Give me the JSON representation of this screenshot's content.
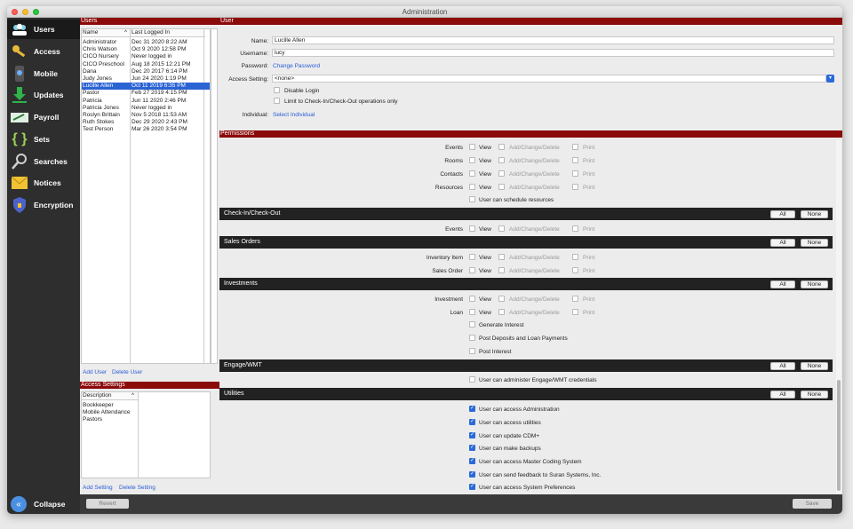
{
  "window": {
    "title": "Administration"
  },
  "nav": {
    "items": [
      {
        "label": "Users",
        "icon": "users-icon",
        "active": true
      },
      {
        "label": "Access",
        "icon": "key-icon"
      },
      {
        "label": "Mobile",
        "icon": "mobile-icon"
      },
      {
        "label": "Updates",
        "icon": "download-icon"
      },
      {
        "label": "Payroll",
        "icon": "payroll-icon"
      },
      {
        "label": "Sets",
        "icon": "braces-icon"
      },
      {
        "label": "Searches",
        "icon": "magnifier-icon"
      },
      {
        "label": "Notices",
        "icon": "envelope-icon"
      },
      {
        "label": "Encryption",
        "icon": "shield-icon"
      }
    ],
    "collapse_label": "Collapse"
  },
  "users_panel": {
    "header": "Users",
    "col_name": "Name",
    "col_last": "Last Logged In",
    "rows": [
      {
        "name": "Administrator",
        "last": "Dec 31 2020 8:22 AM"
      },
      {
        "name": "Chris Watson",
        "last": "Oct 9 2020 12:58 PM"
      },
      {
        "name": "CICO Nursery",
        "last": "Never logged in"
      },
      {
        "name": "CICO Preschool",
        "last": "Aug 18 2015 12:21 PM"
      },
      {
        "name": "Dana",
        "last": "Dec 20 2017 6:14 PM"
      },
      {
        "name": "Judy Jones",
        "last": "Jun 24 2020 1:19 PM"
      },
      {
        "name": "Lucille Allen",
        "last": "Oct 11 2019 6:35 PM",
        "selected": true
      },
      {
        "name": "Pastor",
        "last": "Feb 27 2019 4:15 PM"
      },
      {
        "name": "Patricia",
        "last": "Jun 11 2020 2:46 PM"
      },
      {
        "name": "Patricia Jones",
        "last": "Never logged in"
      },
      {
        "name": "Roslyn Brittain",
        "last": "Nov 5 2018 11:53 AM"
      },
      {
        "name": "Ruth Stokes",
        "last": "Dec 29 2020 2:43 PM"
      },
      {
        "name": "Test Person",
        "last": "Mar 26 2020 3:54 PM"
      }
    ],
    "add_user": "Add User",
    "delete_user": "Delete User"
  },
  "access_panel": {
    "header": "Access Settings",
    "col_desc": "Description",
    "rows": [
      "Bookkeeper",
      "Mobile Attendance",
      "Pastors"
    ],
    "add_setting": "Add Setting",
    "delete_setting": "Delete Setting"
  },
  "user_form": {
    "header": "User",
    "name_label": "Name:",
    "name_value": "Lucille Allen",
    "username_label": "Username:",
    "username_value": "lucy",
    "password_label": "Password:",
    "change_password": "Change Password",
    "access_label": "Access Setting:",
    "access_value": "<none>",
    "disable_login": "Disable Login",
    "limit_checkin": "Limit to Check-In/Check-Out operations only",
    "individual_label": "Individual:",
    "select_individual": "Select Individual"
  },
  "permissions": {
    "header": "Permissions",
    "view": "View",
    "add_change_delete": "Add/Change/Delete",
    "print": "Print",
    "all": "All",
    "none": "None",
    "top_rows": [
      "Events",
      "Rooms",
      "Contacts",
      "Resources"
    ],
    "schedule_resources": "User can schedule resources",
    "sections": [
      {
        "title": "Check-In/Check-Out",
        "rows": [
          "Events"
        ]
      },
      {
        "title": "Sales Orders",
        "rows": [
          "Inventory Item",
          "Sales Order"
        ]
      },
      {
        "title": "Investments",
        "rows": [
          "Investment",
          "Loan"
        ],
        "extras": [
          "Generate Interest",
          "Post Deposits and Loan Payments",
          "Post Interest"
        ]
      },
      {
        "title": "Engage/WMT",
        "extras": [
          "User can administer Engage/WMT credentials"
        ]
      },
      {
        "title": "Utilities",
        "checked_extras": [
          "User can access Administration",
          "User can access utilities",
          "User can update CDM+",
          "User can make backups",
          "User can access Master Coding System",
          "User can send feedback to Suran Systems, Inc.",
          "User can access System Preferences"
        ]
      }
    ]
  },
  "bottom": {
    "revert": "Revert",
    "save": "Save"
  }
}
